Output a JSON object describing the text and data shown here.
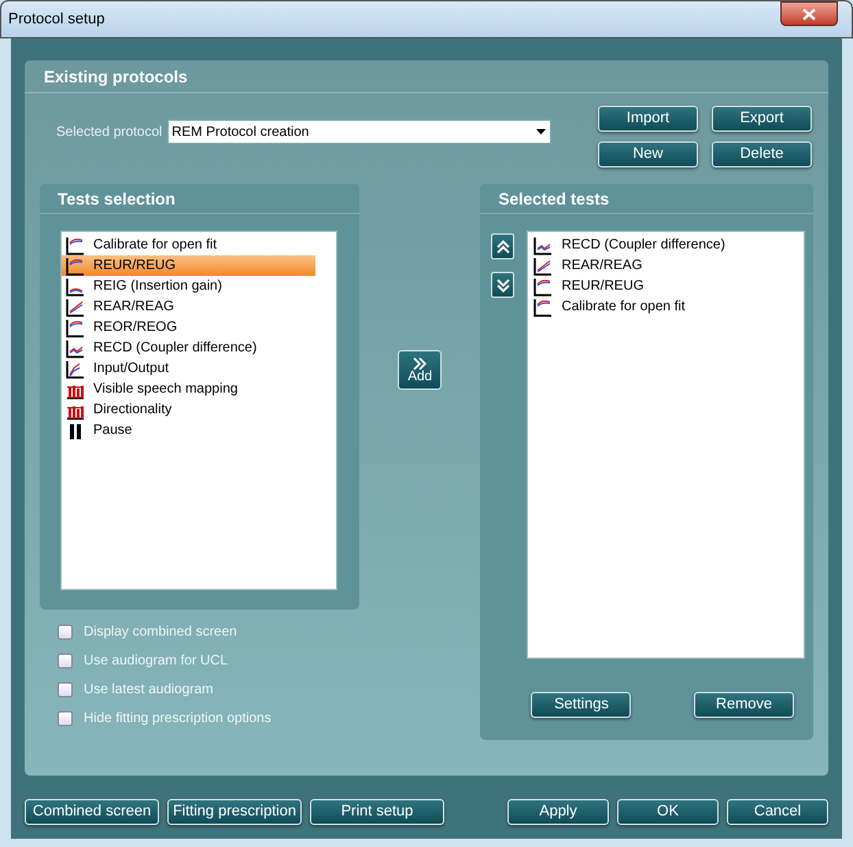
{
  "window": {
    "title": "Protocol setup"
  },
  "existing_protocols": {
    "title": "Existing protocols",
    "selected_label": "Selected protocol",
    "selected_value": "REM Protocol creation",
    "buttons": [
      "Import",
      "Export",
      "New",
      "Delete"
    ]
  },
  "tests_selection": {
    "title": "Tests selection",
    "items": [
      {
        "label": "Calibrate for open fit",
        "kind": "curve",
        "selected": false
      },
      {
        "label": "REUR/REUG",
        "kind": "curve",
        "selected": true
      },
      {
        "label": "REIG (Insertion gain)",
        "kind": "gain",
        "selected": false
      },
      {
        "label": "REAR/REAG",
        "kind": "rise",
        "selected": false
      },
      {
        "label": "REOR/REOG",
        "kind": "curve",
        "selected": false
      },
      {
        "label": "RECD (Coupler difference)",
        "kind": "wave",
        "selected": false
      },
      {
        "label": "Input/Output",
        "kind": "io",
        "selected": false
      },
      {
        "label": "Visible speech mapping",
        "kind": "bars",
        "selected": false
      },
      {
        "label": "Directionality",
        "kind": "bars",
        "selected": false
      },
      {
        "label": "Pause",
        "kind": "pause",
        "selected": false
      }
    ]
  },
  "add_button": "Add",
  "selected_tests": {
    "title": "Selected tests",
    "items": [
      {
        "label": "RECD (Coupler difference)",
        "kind": "wave"
      },
      {
        "label": "REAR/REAG",
        "kind": "rise"
      },
      {
        "label": "REUR/REUG",
        "kind": "curve"
      },
      {
        "label": "Calibrate for open fit",
        "kind": "curve"
      }
    ],
    "buttons": [
      "Settings",
      "Remove"
    ]
  },
  "options": [
    {
      "label": "Display combined screen",
      "checked": false
    },
    {
      "label": "Use audiogram for UCL",
      "checked": false
    },
    {
      "label": "Use latest audiogram",
      "checked": false
    },
    {
      "label": "Hide fitting prescription options",
      "checked": false
    }
  ],
  "footer_left": [
    "Combined screen",
    "Fitting prescription",
    "Print setup"
  ],
  "footer_right": [
    "Apply",
    "OK",
    "Cancel"
  ]
}
